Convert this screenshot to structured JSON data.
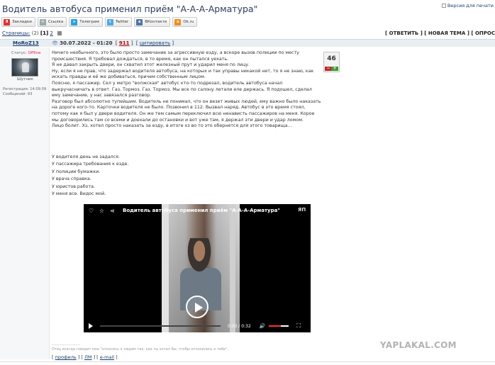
{
  "page": {
    "title": "Водитель автобуса применил приём \"А-А-А-Арматура\"",
    "version_link": "Версия для печати"
  },
  "share": [
    {
      "label": "Закладки",
      "icon": "bookmarks-icon",
      "color": "#d33"
    },
    {
      "label": "Ссылка",
      "icon": "mail-icon",
      "color": "#888"
    },
    {
      "label": "Телеграм",
      "icon": "telegram-icon",
      "color": "#2aa3d9"
    },
    {
      "label": "Twitter",
      "icon": "twitter-icon",
      "color": "#4aa9e8"
    },
    {
      "label": "ВКонтакте",
      "icon": "vk-icon",
      "color": "#5074a6"
    },
    {
      "label": "Ok.ru",
      "icon": "ok-icon",
      "color": "#f08c1e"
    }
  ],
  "pager": {
    "label": "Страницы:",
    "count": "(2)",
    "current": "[1]",
    "next": "2"
  },
  "actions": "[ ОТВЕТИТЬ ] [ НОВАЯ ТЕМА ] [ ОПРОС",
  "post": {
    "author": "MoRoZ13",
    "date": "30.07.2022 - 01:20",
    "number": "911",
    "quote": "цитировать",
    "status_label": "Статус:",
    "status_value": "Offline",
    "rank": "Шутник",
    "registered": "Регистрация: 14.09.09",
    "messages": "Сообщений: 93",
    "rating": "46",
    "paragraphs": [
      "Ничего необычного, это было просто замечание за агрессивную езду, а вскоре вызов полиции по месту происшествия. Я требовал дождаться, в то время, как он пытался уехать.",
      "Я не давал закрыть двери, он схватил этот железный прут и ударил меня по лицу.",
      "Ну, если я не прав, что задержал водителя автобуса, на которых и так управы никакой нет, то я не знаю, как искать правды и её же добиваться, причем собственным лицом.",
      "Поясню, я пассажир. Сел у метро \"волжская\" автобус кто-то подрезал, водитель автобуса начал выкручасничать в ответ. Газ. Тормоз. Газ. Тормоз. Мы все по салону летали еле держась. Я подошел, сделал ему замечание, у нас завязался разговор.",
      "Разговор был абсолютно тупейшим. Водитель не понимал, что он везет живых людей, ему важно было наказать на дороге кого-то. Карточки водителя не было. Позвонил в 112. Вызвал наряд. Автобус в это время стоял, потому как я был у двери водителя. Он же тем самым переключил всю ненависть пассажиров на меня. Корое мы договорились там со всеми и доехали до остановки и вот уже там, я держал эти двери и удар ломом.",
      "Лицо болит. Хз, хотел просто наказать за езду, в итоге хз во то это обернется для этого товарища..."
    ],
    "list": [
      "У водителя день не задался.",
      "У пассажира требования к езде.",
      "У полиции бумажки.",
      "У врача справка.",
      "У юристов работа.",
      "У меня все. Видос мой."
    ],
    "video": {
      "title": "Водитель автобуса применил приём \"А-А-А-Арматура\"",
      "time": "0:00 / 0:32",
      "logo": "ЯП"
    },
    "signature_line": "--------------------",
    "signature": "Отец всегда говорит мне \"относись к людям так, как ты хотел бы, чтобы относились к тебе\".",
    "links": [
      "профиль",
      "ЛМ",
      "e-mail"
    ]
  },
  "watermark": "YAPLAKAL.COM"
}
